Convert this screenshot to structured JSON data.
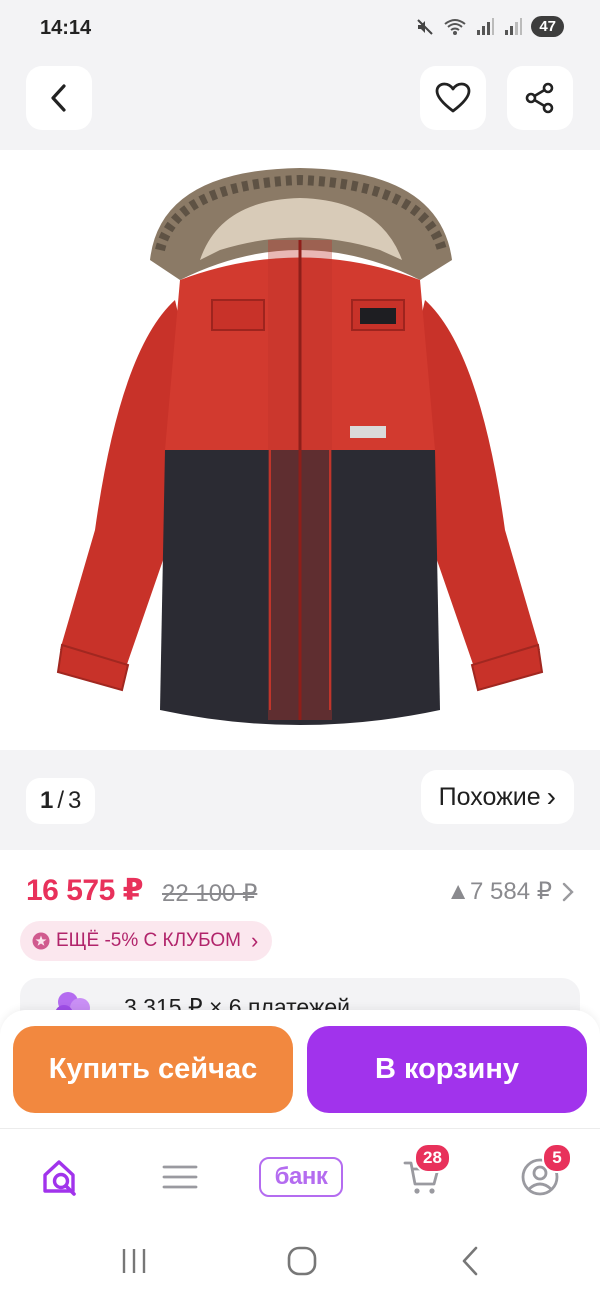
{
  "status_bar": {
    "time": "14:14",
    "battery": "47",
    "network": "5"
  },
  "header": {
    "back_icon": "chevron-left-icon",
    "favorite_icon": "heart-icon",
    "share_icon": "share-icon"
  },
  "gallery": {
    "current": "1",
    "separator": "/",
    "total": "3",
    "similar_label": "Похожие",
    "similar_arrow": "›"
  },
  "product": {
    "price": "16 575 ₽",
    "old_price": "22 100 ₽",
    "price_diff": "▲7 584 ₽",
    "club_badge": "ЕЩЁ -5% С КЛУБОМ",
    "club_arrow": "›",
    "installment": "3 315 ₽ × 6 платежей",
    "jacket_tag": "KERRY"
  },
  "actions": {
    "buy_now": "Купить сейчас",
    "add_to_cart": "В корзину"
  },
  "bottom_nav": {
    "bank_label": "банк",
    "cart_badge": "28",
    "profile_badge": "5"
  },
  "colors": {
    "accent_pink": "#e8315b",
    "buy_orange": "#f2883f",
    "cart_purple": "#a133ec",
    "nav_purple": "#a133ec"
  }
}
